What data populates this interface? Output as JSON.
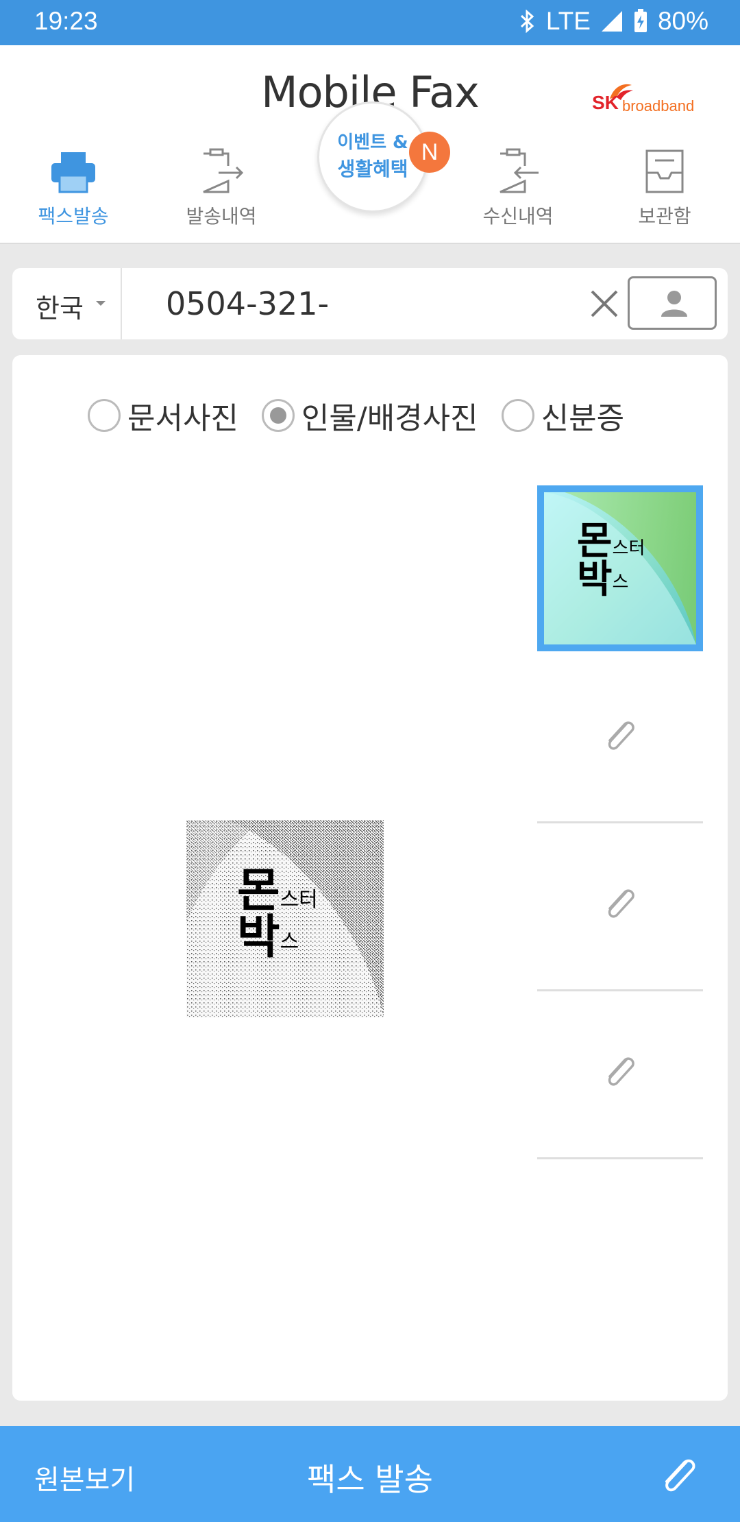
{
  "status_bar": {
    "time": "19:23",
    "network": "LTE",
    "battery": "80%",
    "icons": [
      "bluetooth-icon",
      "signal-icon",
      "battery-charging-icon"
    ]
  },
  "header": {
    "title": "Mobile Fax",
    "logo_sk": "SK",
    "logo_broadband": "broadband",
    "event_line1": "이벤트 &",
    "event_line2": "생활혜택",
    "event_badge": "N",
    "tabs": [
      {
        "label": "팩스발송",
        "icon": "fax-printer-icon",
        "active": true
      },
      {
        "label": "발송내역",
        "icon": "sent-history-icon",
        "active": false
      },
      {
        "label": "수신내역",
        "icon": "received-history-icon",
        "active": false
      },
      {
        "label": "보관함",
        "icon": "storage-box-icon",
        "active": false
      }
    ]
  },
  "number_bar": {
    "country": "한국",
    "number": "0504-321-"
  },
  "image_type": {
    "options": [
      {
        "label": "문서사진",
        "selected": false
      },
      {
        "label": "인물/배경사진",
        "selected": true
      },
      {
        "label": "신분증",
        "selected": false
      }
    ]
  },
  "preview": {
    "text_big1": "몬",
    "text_small1": "스터",
    "text_big2": "박",
    "text_small2": "스"
  },
  "bottom_bar": {
    "view_original": "원본보기",
    "send_fax": "팩스 발송"
  },
  "colors": {
    "accent": "#3f95e0",
    "bottom_bar": "#4aa4f2",
    "badge": "#f4773d"
  }
}
